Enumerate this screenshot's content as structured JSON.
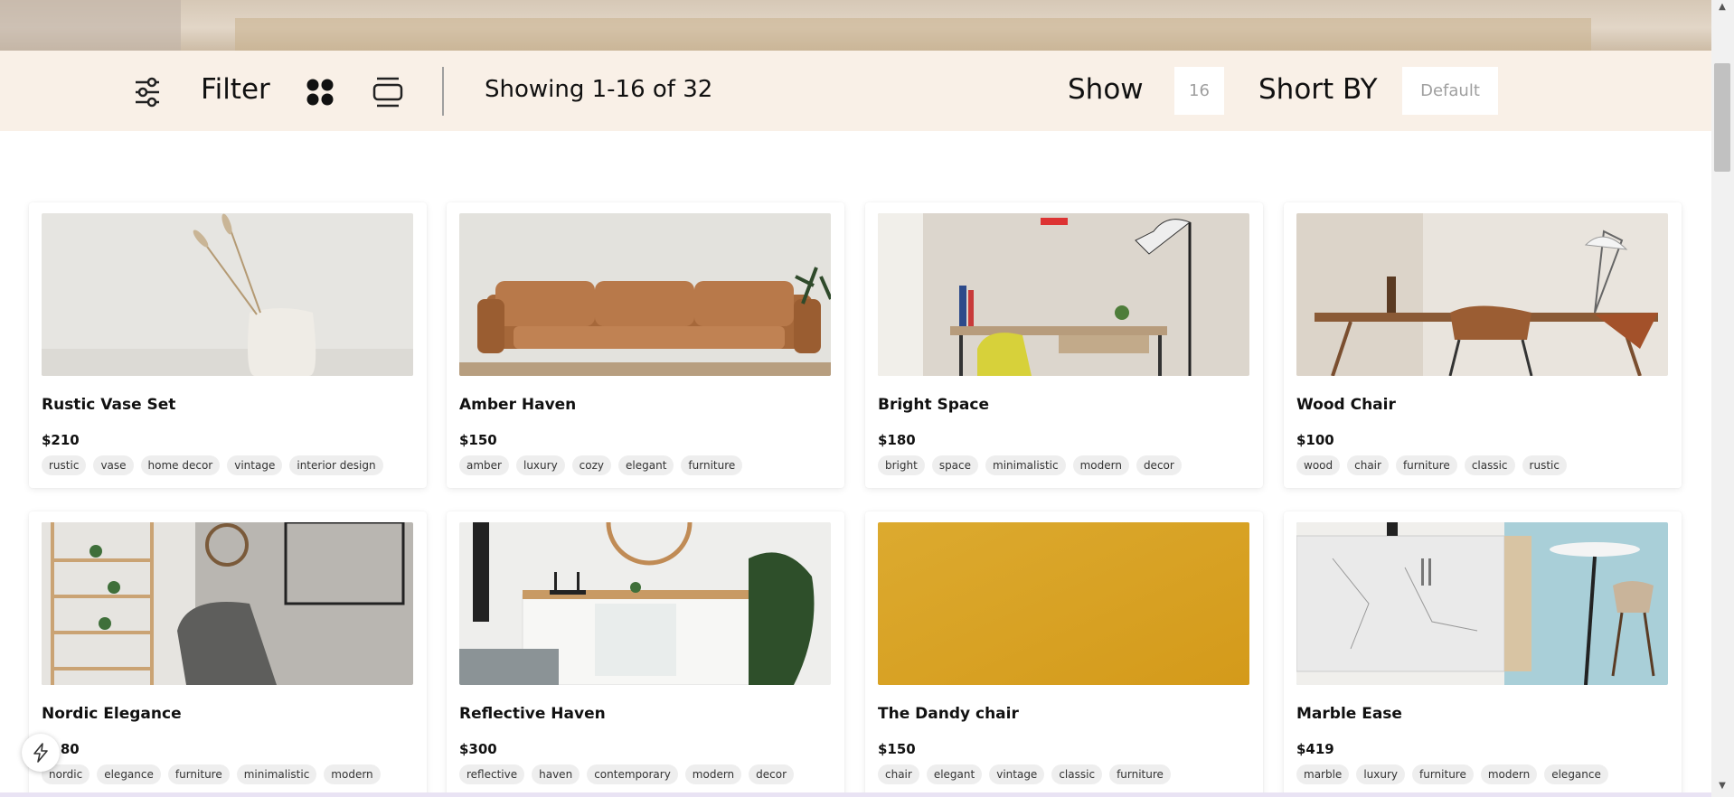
{
  "filterbar": {
    "filter_label": "Filter",
    "showing_text": "Showing 1-16 of 32",
    "show_label": "Show",
    "show_value": "16",
    "sort_label": "Short BY",
    "sort_value": "Default"
  },
  "products": [
    {
      "title": "Rustic Vase Set",
      "price": "$210",
      "tags": [
        "rustic",
        "vase",
        "home decor",
        "vintage",
        "interior design"
      ]
    },
    {
      "title": "Amber Haven",
      "price": "$150",
      "tags": [
        "amber",
        "luxury",
        "cozy",
        "elegant",
        "furniture"
      ]
    },
    {
      "title": "Bright Space",
      "price": "$180",
      "tags": [
        "bright",
        "space",
        "minimalistic",
        "modern",
        "decor"
      ]
    },
    {
      "title": "Wood Chair",
      "price": "$100",
      "tags": [
        "wood",
        "chair",
        "furniture",
        "classic",
        "rustic"
      ]
    },
    {
      "title": "Nordic Elegance",
      "price": "$180",
      "tags": [
        "nordic",
        "elegance",
        "furniture",
        "minimalistic",
        "modern"
      ]
    },
    {
      "title": "Reflective Haven",
      "price": "$300",
      "tags": [
        "reflective",
        "haven",
        "contemporary",
        "modern",
        "decor"
      ]
    },
    {
      "title": "The Dandy chair",
      "price": "$150",
      "tags": [
        "chair",
        "elegant",
        "vintage",
        "classic",
        "furniture"
      ]
    },
    {
      "title": "Marble Ease",
      "price": "$419",
      "tags": [
        "marble",
        "luxury",
        "furniture",
        "modern",
        "elegance"
      ]
    }
  ],
  "icons": {
    "filter": "sliders-icon",
    "grid": "grid-view-icon",
    "list": "list-view-icon",
    "assistant": "lightning-icon"
  },
  "colors": {
    "filterbar_bg": "#f9f0e7",
    "tag_bg": "#eeeeee",
    "dandy_yellow": "#d9a52a"
  }
}
